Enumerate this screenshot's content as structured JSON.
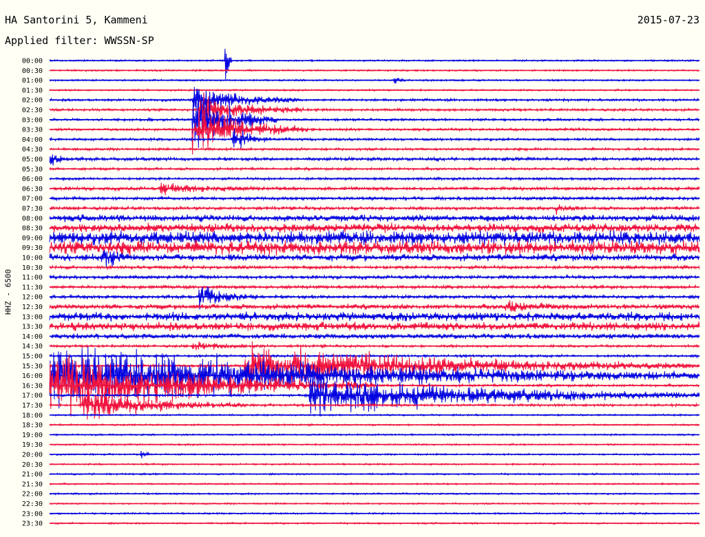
{
  "header": {
    "station": "HA Santorini 5, Kammeni",
    "date": "2015-07-23",
    "filter_text": "Applied filter: WWSSN-SP",
    "channel": "HHZ - 6500"
  },
  "colors": {
    "blue": "#0000E0",
    "red": "#F0103C",
    "background": "#FFFFF6"
  },
  "chart_data": {
    "type": "helicorder",
    "row_labels": [
      "00:00",
      "00:30",
      "01:00",
      "01:30",
      "02:00",
      "02:30",
      "03:00",
      "03:30",
      "04:00",
      "04:30",
      "05:00",
      "05:30",
      "06:00",
      "06:30",
      "07:00",
      "07:30",
      "08:00",
      "08:30",
      "09:00",
      "09:30",
      "10:00",
      "10:30",
      "11:00",
      "11:30",
      "12:00",
      "12:30",
      "13:00",
      "13:30",
      "14:00",
      "14:30",
      "15:00",
      "15:30",
      "16:00",
      "16:30",
      "17:00",
      "17:30",
      "18:00",
      "18:30",
      "19:00",
      "19:30",
      "20:00",
      "20:30",
      "21:00",
      "21:30",
      "22:00",
      "22:30",
      "23:00",
      "23:30"
    ],
    "row_colors": [
      "blue",
      "red"
    ],
    "noise_level": [
      1,
      1,
      1,
      1,
      1.5,
      1.5,
      1.5,
      1.5,
      1.5,
      1.5,
      2,
      1.5,
      1.5,
      2,
      2,
      2,
      4,
      5,
      8,
      8,
      4,
      2,
      2,
      2,
      2,
      3,
      5,
      5,
      3,
      1.5,
      1.5,
      1.5,
      1.5,
      1.5,
      1.5,
      1.5,
      1,
      1,
      1,
      1,
      1,
      1,
      1,
      1,
      1,
      1,
      1,
      1
    ],
    "events": [
      {
        "row": 0,
        "t": 0.27,
        "amp": 40,
        "dur": 0.01
      },
      {
        "row": 2,
        "t": 0.53,
        "amp": 6,
        "dur": 0.02
      },
      {
        "row": 4,
        "t": 0.22,
        "amp": 22,
        "dur": 0.16
      },
      {
        "row": 5,
        "t": 0.23,
        "amp": 22,
        "dur": 0.16
      },
      {
        "row": 6,
        "t": 0.22,
        "amp": 45,
        "dur": 0.13
      },
      {
        "row": 7,
        "t": 0.22,
        "amp": 30,
        "dur": 0.19
      },
      {
        "row": 8,
        "t": 0.28,
        "amp": 20,
        "dur": 0.06
      },
      {
        "row": 10,
        "t": 0.0,
        "amp": 14,
        "dur": 0.03
      },
      {
        "row": 13,
        "t": 0.17,
        "amp": 8,
        "dur": 0.16
      },
      {
        "row": 15,
        "t": 0.78,
        "amp": 8,
        "dur": 0.04
      },
      {
        "row": 20,
        "t": 0.08,
        "amp": 12,
        "dur": 0.05
      },
      {
        "row": 24,
        "t": 0.23,
        "amp": 16,
        "dur": 0.09
      },
      {
        "row": 25,
        "t": 0.7,
        "amp": 7,
        "dur": 0.12
      },
      {
        "row": 29,
        "t": 0.22,
        "amp": 6,
        "dur": 0.12
      },
      {
        "row": 31,
        "t": 0.3,
        "amp": 30,
        "dur": 0.7
      },
      {
        "row": 32,
        "t": 0.0,
        "amp": 42,
        "dur": 1.0
      },
      {
        "row": 33,
        "t": 0.0,
        "amp": 45,
        "dur": 0.5
      },
      {
        "row": 34,
        "t": 0.4,
        "amp": 28,
        "dur": 0.6
      },
      {
        "row": 35,
        "t": 0.05,
        "amp": 22,
        "dur": 0.25
      },
      {
        "row": 40,
        "t": 0.14,
        "amp": 5,
        "dur": 0.02
      }
    ]
  }
}
